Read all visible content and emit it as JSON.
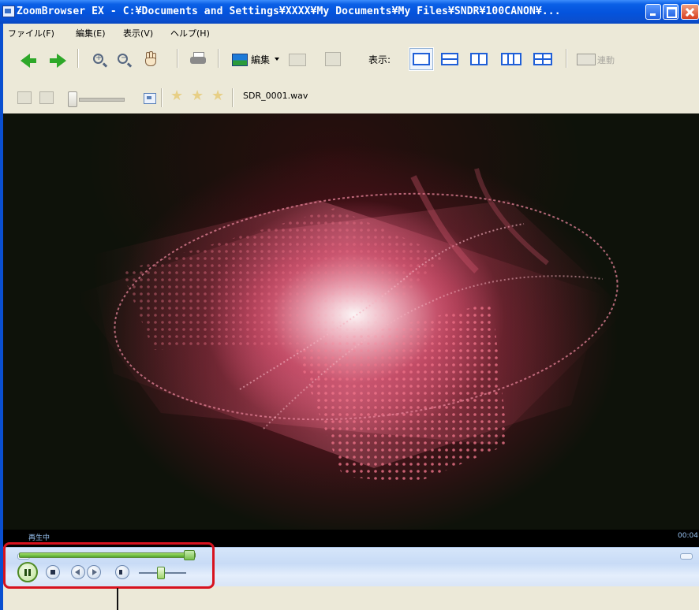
{
  "window": {
    "title": "ZoomBrowser EX - C:¥Documents and Settings¥XXXX¥My Documents¥My Files¥SNDR¥100CANON¥..."
  },
  "menu": {
    "items": [
      "ファイル(F)",
      "編集(E)",
      "表示(V)",
      "ヘルプ(H)"
    ]
  },
  "toolbar": {
    "edit_label": "編集",
    "view_label": "表示:",
    "sync_label": "連動",
    "active_view_index": 0
  },
  "toolbar2": {
    "file_name": "SDR_0001.wav",
    "star_count": 3,
    "rating": 0
  },
  "player": {
    "status": "再生中",
    "time": "00:04",
    "seek_fraction": 0.97,
    "volume_fraction": 0.45
  },
  "icons": {
    "back": "back-arrow-icon",
    "forward": "forward-arrow-icon",
    "zoom_in": "zoom-in-icon",
    "zoom_out": "zoom-out-icon",
    "hand": "hand-icon",
    "print": "printer-icon"
  },
  "colors": {
    "title_bar": "#0453dc",
    "highlight": "#d8121e",
    "visualizer": "#e0405e"
  }
}
